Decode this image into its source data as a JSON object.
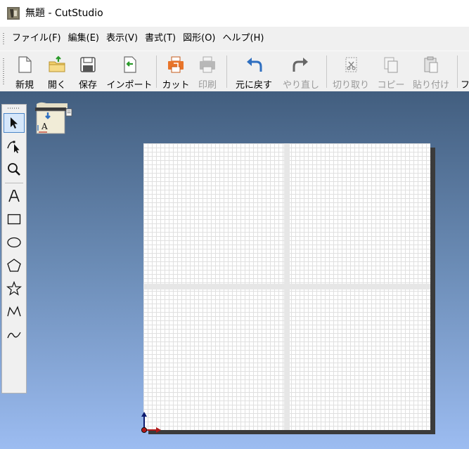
{
  "window": {
    "title": "無題 - CutStudio"
  },
  "menu": {
    "items": [
      "ファイル(F)",
      "編集(E)",
      "表示(V)",
      "書式(T)",
      "図形(O)",
      "ヘルプ(H)"
    ]
  },
  "toolbar": {
    "buttons": [
      {
        "label": "新規",
        "icon": "new-document-icon",
        "enabled": true
      },
      {
        "label": "開く",
        "icon": "open-folder-icon",
        "enabled": true
      },
      {
        "label": "保存",
        "icon": "save-disk-icon",
        "enabled": true
      },
      {
        "label": "インポート",
        "icon": "import-icon",
        "enabled": true
      },
      {
        "label": "カット",
        "icon": "cut-printer-icon",
        "enabled": true
      },
      {
        "label": "印刷",
        "icon": "print-icon",
        "enabled": false
      },
      {
        "label": "元に戻す",
        "icon": "undo-icon",
        "enabled": true
      },
      {
        "label": "やり直し",
        "icon": "redo-icon",
        "enabled": false
      },
      {
        "label": "切り取り",
        "icon": "cut-icon",
        "enabled": false
      },
      {
        "label": "コピー",
        "icon": "copy-icon",
        "enabled": false
      },
      {
        "label": "貼り付け",
        "icon": "paste-icon",
        "enabled": false
      }
    ]
  },
  "tools": [
    {
      "name": "select-tool",
      "icon": "arrow-icon",
      "selected": true
    },
    {
      "name": "node-edit-tool",
      "icon": "node-arrow-icon"
    },
    {
      "name": "zoom-tool",
      "icon": "magnifier-icon"
    },
    {
      "name": "text-tool",
      "icon": "letter-a-icon"
    },
    {
      "name": "rectangle-tool",
      "icon": "rectangle-icon"
    },
    {
      "name": "ellipse-tool",
      "icon": "ellipse-icon"
    },
    {
      "name": "polygon-tool",
      "icon": "pentagon-icon"
    },
    {
      "name": "star-tool",
      "icon": "star-icon"
    },
    {
      "name": "polyline-tool",
      "icon": "polyline-icon"
    },
    {
      "name": "curve-tool",
      "icon": "curve-icon"
    }
  ],
  "colors": {
    "accent_orange": "#e8742a",
    "undo_blue": "#2f6fc0",
    "import_green": "#2a9a2a",
    "workarea_top": "#425e7f",
    "workarea_bottom": "#9cbcf1"
  }
}
